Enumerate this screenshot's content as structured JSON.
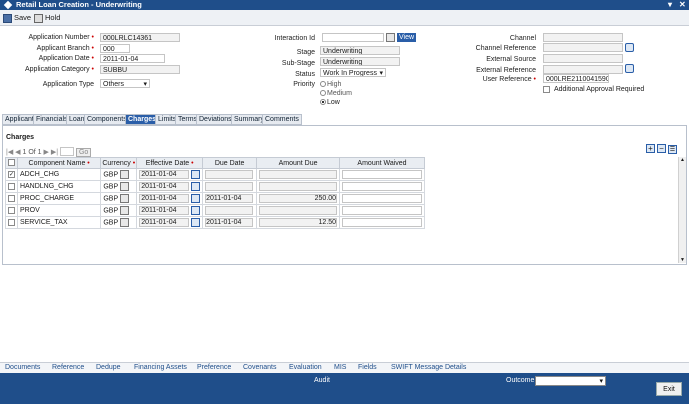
{
  "window": {
    "title": "Retail Loan Creation - Underwriting"
  },
  "toolbar": {
    "save_label": "Save",
    "hold_label": "Hold"
  },
  "form": {
    "application_number": {
      "label": "Application Number",
      "value": "000LRLC14361"
    },
    "applicant_branch": {
      "label": "Applicant Branch",
      "value": "000"
    },
    "application_date": {
      "label": "Application Date",
      "value": "2011-01-04"
    },
    "application_category": {
      "label": "Application Category",
      "value": "SUBBU"
    },
    "application_type": {
      "label": "Application Type",
      "value": "Others"
    },
    "interaction_id": {
      "label": "Interaction Id",
      "value": "",
      "view_label": "View"
    },
    "stage": {
      "label": "Stage",
      "value": "Underwriting"
    },
    "sub_stage": {
      "label": "Sub-Stage",
      "value": "Underwriting"
    },
    "status": {
      "label": "Status",
      "value": "Work In Progress"
    },
    "priority": {
      "label": "Priority",
      "options": [
        "High",
        "Medium",
        "Low"
      ],
      "selected": "Low"
    },
    "channel": {
      "label": "Channel",
      "value": ""
    },
    "channel_reference": {
      "label": "Channel Reference",
      "value": ""
    },
    "external_source": {
      "label": "External Source",
      "value": ""
    },
    "external_reference": {
      "label": "External Reference",
      "value": ""
    },
    "user_reference": {
      "label": "User Reference",
      "value": "000LRE2110041590"
    },
    "additional_approval": {
      "label": "Additional Approval Required",
      "checked": false
    }
  },
  "tabs": [
    "Applicant",
    "Financials",
    "Loan",
    "Components",
    "Charges",
    "Limits",
    "Terms",
    "Deviations",
    "Summary",
    "Comments"
  ],
  "active_tab": "Charges",
  "charges": {
    "section_title": "Charges",
    "pager": {
      "page_text": "1 Of 1",
      "go_label": "Go"
    },
    "columns": {
      "component_name": "Component Name",
      "currency": "Currency",
      "effective_date": "Effective Date",
      "due_date": "Due Date",
      "amount_due": "Amount Due",
      "amount_waived": "Amount Waived"
    },
    "rows": [
      {
        "checked": true,
        "component": "ADCH_CHG",
        "currency": "GBP",
        "effective_date": "2011-01-04",
        "due_date": "",
        "amount_due": "",
        "amount_waived": ""
      },
      {
        "checked": false,
        "component": "HANDLNG_CHG",
        "currency": "GBP",
        "effective_date": "2011-01-04",
        "due_date": "",
        "amount_due": "",
        "amount_waived": ""
      },
      {
        "checked": false,
        "component": "PROC_CHARGE",
        "currency": "GBP",
        "effective_date": "2011-01-04",
        "due_date": "2011-01-04",
        "amount_due": "250.00",
        "amount_waived": ""
      },
      {
        "checked": false,
        "component": "PROV",
        "currency": "GBP",
        "effective_date": "2011-01-04",
        "due_date": "",
        "amount_due": "",
        "amount_waived": ""
      },
      {
        "checked": false,
        "component": "SERVICE_TAX",
        "currency": "GBP",
        "effective_date": "2011-01-04",
        "due_date": "2011-01-04",
        "amount_due": "12.50",
        "amount_waived": ""
      }
    ]
  },
  "bottom_links": [
    "Documents",
    "Reference",
    "Dedupe",
    "Financing Assets",
    "Preference",
    "Covenants",
    "Evaluation",
    "MIS",
    "Fields",
    "SWIFT Message Details"
  ],
  "footer": {
    "audit_label": "Audit",
    "outcome_label": "Outcome",
    "outcome_value": "",
    "exit_label": "Exit"
  }
}
